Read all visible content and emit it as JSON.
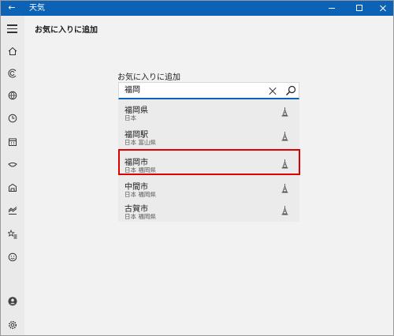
{
  "window": {
    "title": "天気"
  },
  "titlebar": {
    "back_icon": "back-arrow-icon"
  },
  "sidebar": {
    "icons": [
      "home-icon",
      "forecast-icon",
      "maps-icon",
      "clock-icon",
      "calendar-icon",
      "news-icon",
      "building-icon",
      "chart-icon",
      "favorites-icon",
      "smile-icon"
    ],
    "bottom_icons": [
      "account-icon",
      "settings-icon"
    ]
  },
  "header": {
    "title": "お気に入りに追加"
  },
  "panel": {
    "label": "お気に入りに追加",
    "search": {
      "value": "福岡"
    },
    "results": [
      {
        "name": "福岡県",
        "sub": "日本"
      },
      {
        "name": "福岡駅",
        "sub": "日本 富山県"
      },
      {
        "name": "福岡市",
        "sub": "日本 福岡県"
      },
      {
        "name": "中間市",
        "sub": "日本 福岡県"
      },
      {
        "name": "古賀市",
        "sub": "日本 福岡県"
      }
    ]
  },
  "colors": {
    "titlebar": "#0c62b5",
    "highlight": "#e10000",
    "accent": "#0c62b5"
  }
}
